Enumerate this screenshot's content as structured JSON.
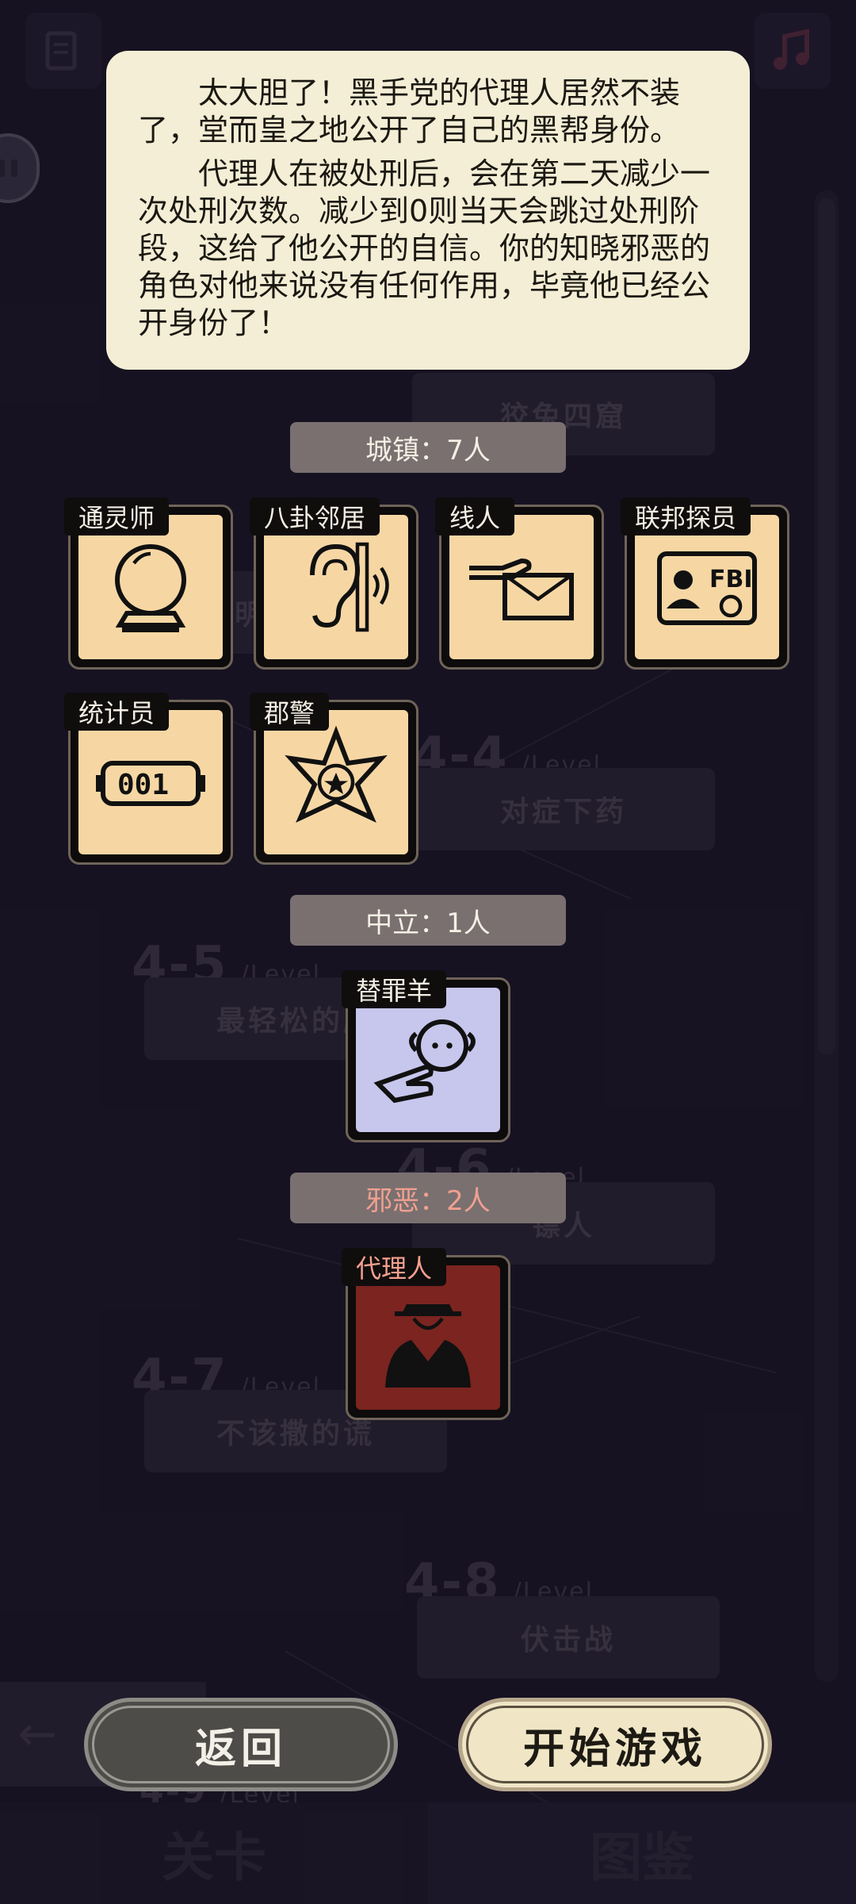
{
  "background": {
    "levels": [
      {
        "number": "4-4",
        "suffix": "/Level",
        "name": "对症下药"
      },
      {
        "number": "4-5",
        "suffix": "/Level",
        "name": "最轻松的胜"
      },
      {
        "number": "4-6",
        "suffix": "/Level",
        "name": "镖人"
      },
      {
        "number": "4-7",
        "suffix": "/Level",
        "name": "不该撒的谎"
      },
      {
        "number": "4-8",
        "suffix": "/Level",
        "name": "伏击战"
      },
      {
        "number": "4-9",
        "suffix": "/Level"
      }
    ],
    "plate_top": "狡兔四窟",
    "plate_partial": "明",
    "arrow": "←",
    "tabs": {
      "left": "关卡",
      "right": "图鉴"
    }
  },
  "tip": {
    "paragraph1": "太大胆了！黑手党的代理人居然不装了，堂而皇之地公开了自己的黑帮身份。",
    "paragraph2": "代理人在被处刑后，会在第二天减少一次处刑次数。减少到0则当天会跳过处刑阶段，这给了他公开的自信。你的知晓邪恶的角色对他来说没有任何作用，毕竟他已经公开身份了！"
  },
  "sections": {
    "town": "城镇：7人",
    "neutral": "中立：1人",
    "evil": "邪恶：2人"
  },
  "roles": {
    "town": [
      {
        "label": "通灵师",
        "icon": "crystal-ball-icon"
      },
      {
        "label": "八卦邻居",
        "icon": "ear-icon"
      },
      {
        "label": "线人",
        "icon": "hand-envelope-icon"
      },
      {
        "label": "联邦探员",
        "icon": "fbi-badge-icon",
        "badge_text": "FBI"
      },
      {
        "label": "统计员",
        "icon": "counter-icon",
        "counter_text": "001"
      },
      {
        "label": "郡警",
        "icon": "sheriff-star-icon"
      }
    ],
    "neutral": [
      {
        "label": "替罪羊",
        "icon": "sheep-pointing-icon"
      }
    ],
    "evil": [
      {
        "label": "代理人",
        "icon": "mobster-icon"
      }
    ]
  },
  "buttons": {
    "back": "返回",
    "start": "开始游戏"
  },
  "colors": {
    "town_card": "#f6d7a4",
    "neutral_card": "#c7c6ec",
    "evil_card": "#7b2420",
    "evil_text": "#f0a090",
    "tip_background": "#f3eed5"
  }
}
